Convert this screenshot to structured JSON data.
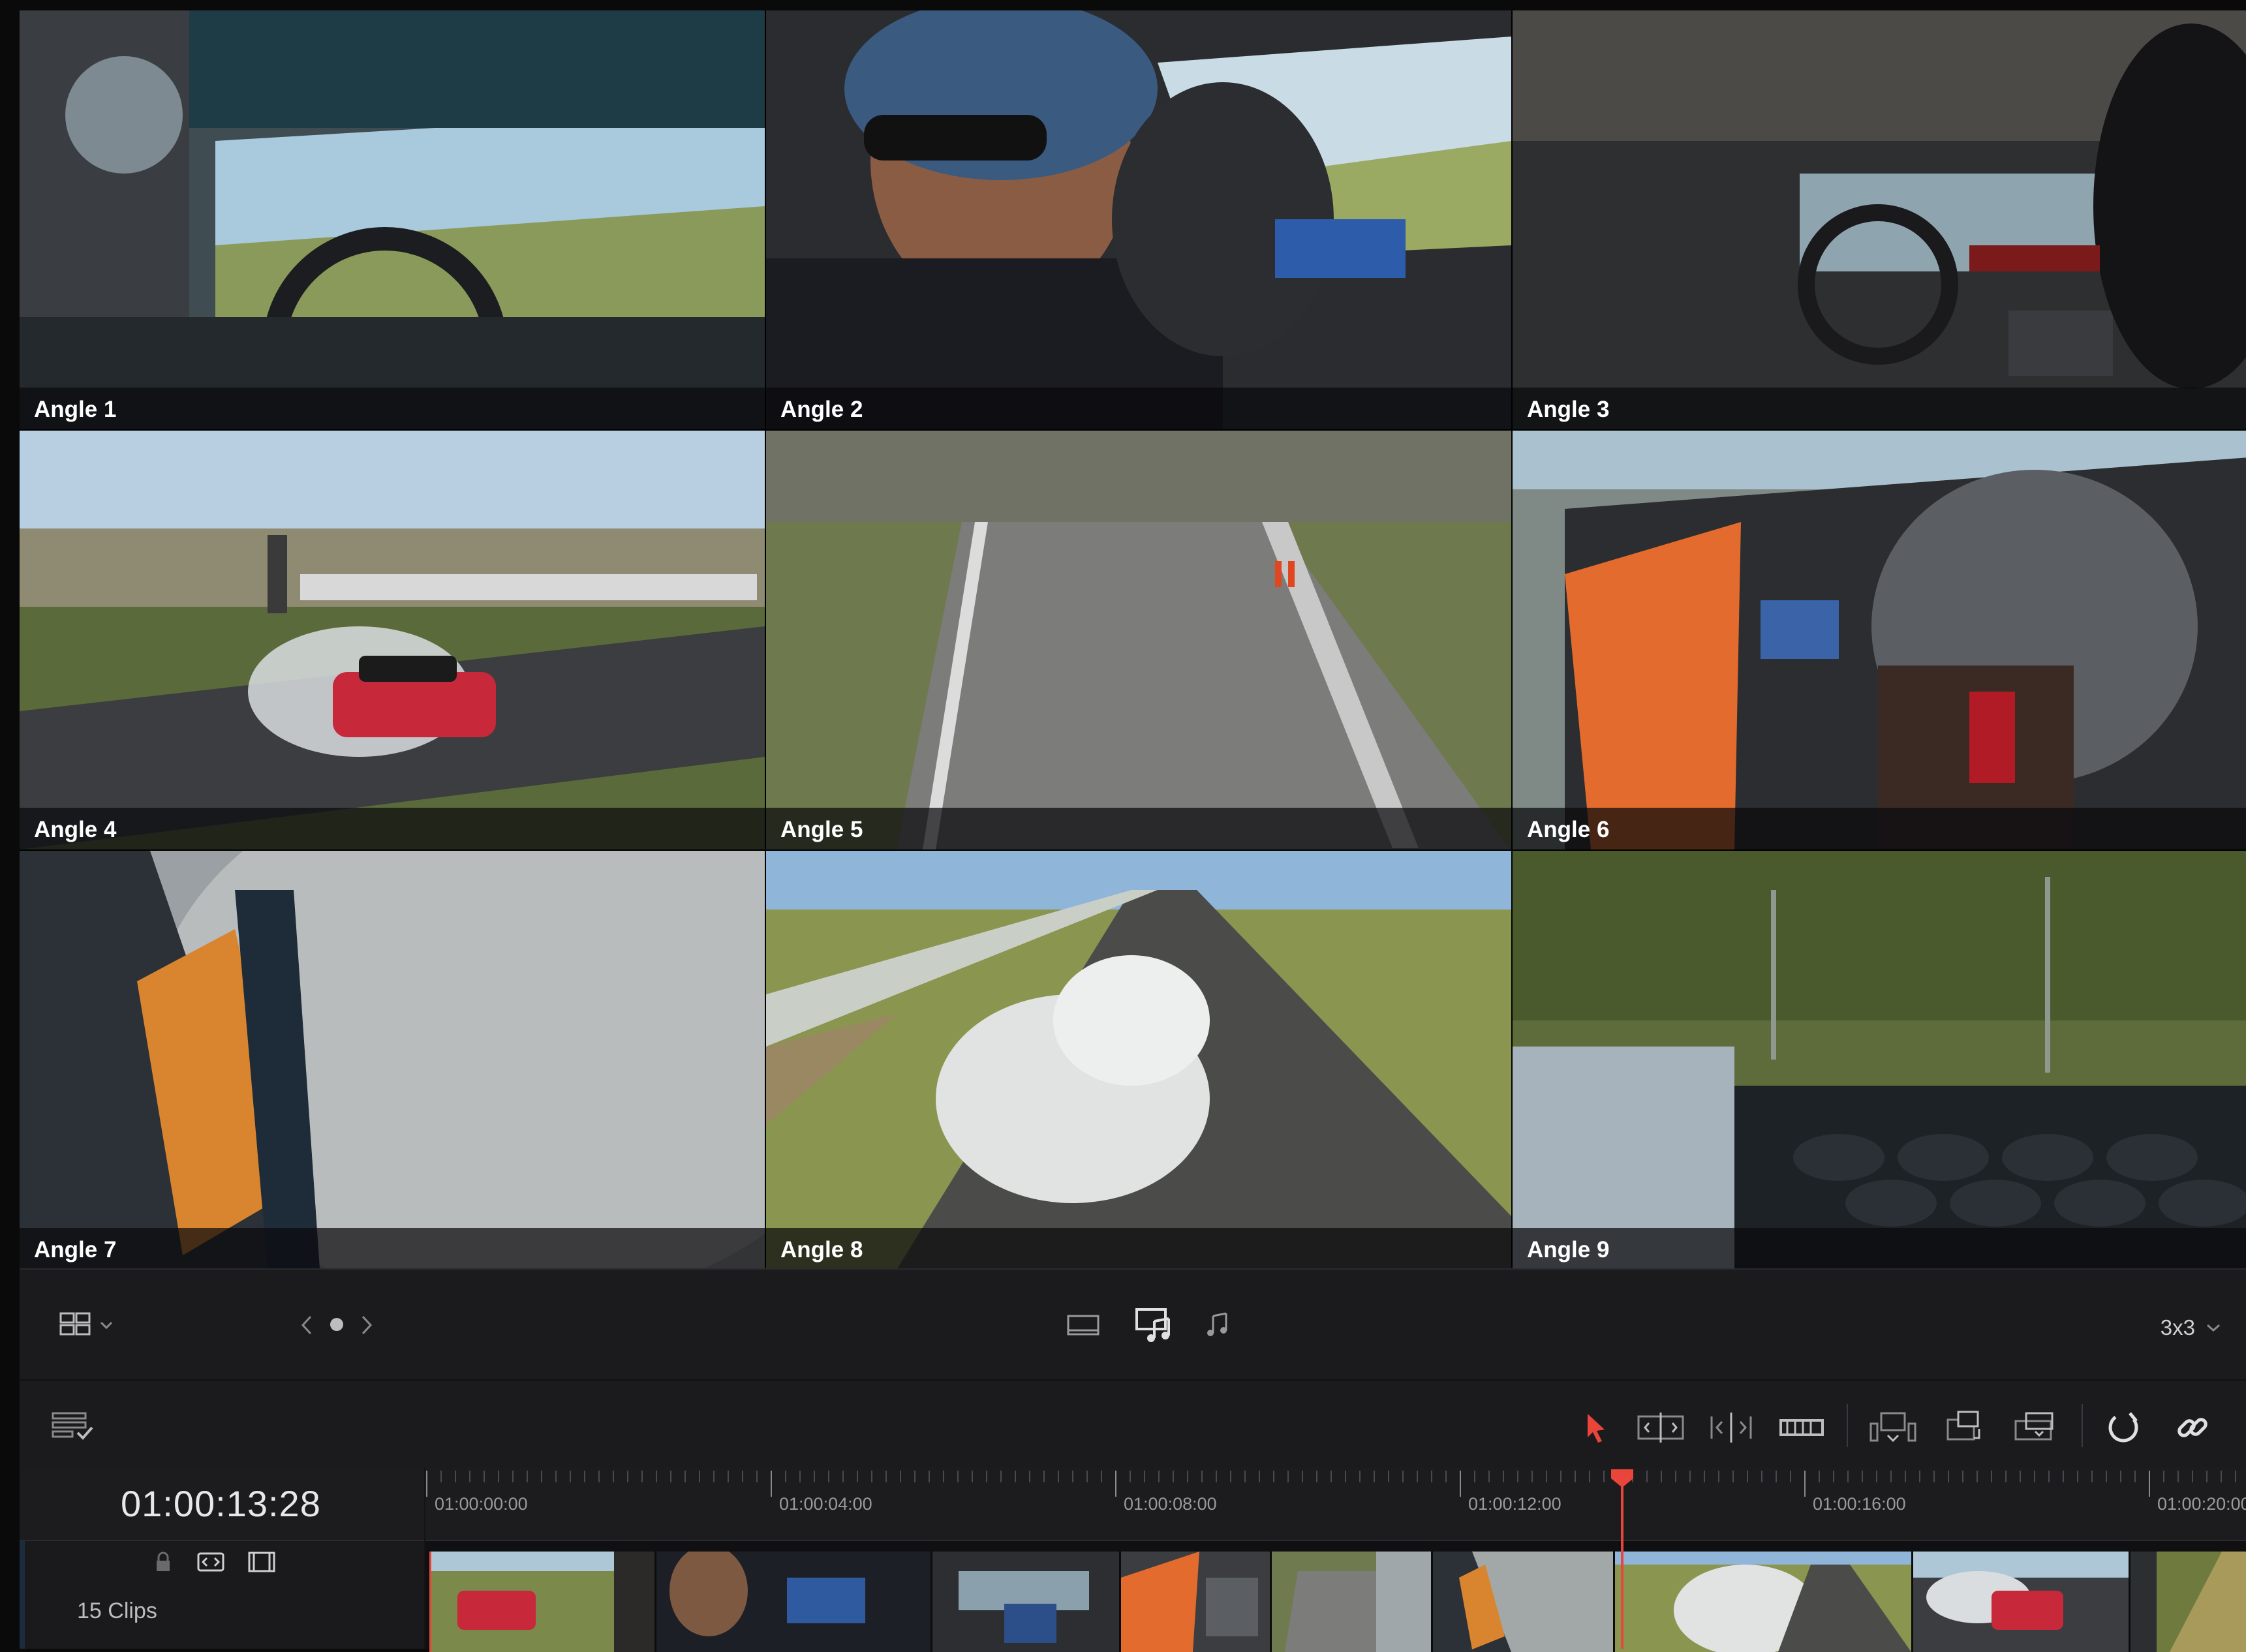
{
  "viewer": {
    "angles": [
      {
        "label": "Angle 1"
      },
      {
        "label": "Angle 2"
      },
      {
        "label": "Angle 3"
      },
      {
        "label": "Angle 4"
      },
      {
        "label": "Angle 5"
      },
      {
        "label": "Angle 6"
      },
      {
        "label": "Angle 7"
      },
      {
        "label": "Angle 8",
        "selected": true
      },
      {
        "label": "Angle 9"
      }
    ],
    "selected_border_color": "#1e9ae8"
  },
  "viewer_toolbar": {
    "layout_icon": "multicam-layout-icon",
    "page_nav": {
      "prev_icon": "chevron-left-icon",
      "next_icon": "chevron-right-icon"
    },
    "switch_modes": [
      "video-only-icon",
      "audio-video-icon",
      "audio-only-icon"
    ],
    "grid_size": "3x3"
  },
  "timeline_toolbar": {
    "tools": [
      "selection-tool-icon",
      "trim-edit-icon",
      "dynamic-trim-icon",
      "blade-tool-icon",
      "insert-clip-icon",
      "overwrite-clip-icon",
      "replace-clip-icon",
      "snapping-icon",
      "linked-selection-icon"
    ],
    "accent_color": "#e9453a"
  },
  "timeline": {
    "timecode": "01:00:13:28",
    "ruler_labels": [
      "01:00:00:00",
      "01:00:04:00",
      "01:00:08:00",
      "01:00:12:00",
      "01:00:16:00",
      "01:00:20:00"
    ],
    "track": {
      "clips_count": "15 Clips"
    },
    "playhead_color": "#e9453a"
  }
}
